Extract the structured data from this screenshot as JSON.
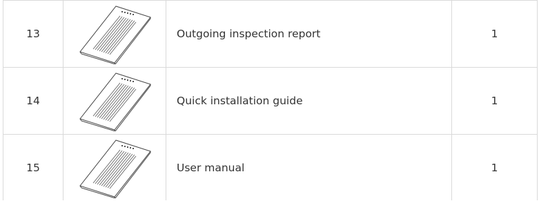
{
  "items": [
    {
      "number": "13",
      "icon": "document-icon",
      "name": "Outgoing inspection report",
      "quantity": "1"
    },
    {
      "number": "14",
      "icon": "document-icon",
      "name": "Quick installation guide",
      "quantity": "1"
    },
    {
      "number": "15",
      "icon": "document-icon",
      "name": "User manual",
      "quantity": "1"
    }
  ]
}
